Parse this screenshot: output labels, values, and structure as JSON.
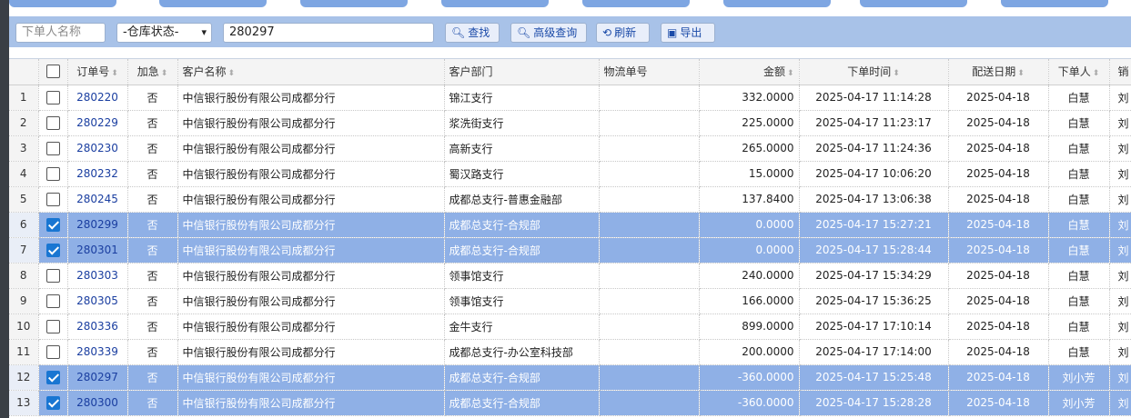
{
  "toolbar": {
    "orderer_placeholder": "下单人名称",
    "warehouse_status": "-仓库状态-",
    "search_value": "280297",
    "search_label": "查找",
    "advanced_label": "高级查询",
    "refresh_label": "刷新",
    "export_label": "导出"
  },
  "table": {
    "headers": [
      "订单号",
      "加急",
      "客户名称",
      "客户部门",
      "物流单号",
      "金额",
      "下单时间",
      "配送日期",
      "下单人",
      "销"
    ],
    "rows": [
      {
        "rn": "1",
        "checked": false,
        "id": "280220",
        "urgent": "否",
        "customer": "中信银行股份有限公司成都分行",
        "dept": "锦江支行",
        "logistics": "",
        "amount": "332.0000",
        "time": "2025-04-17 11:14:28",
        "date": "2025-04-18",
        "user": "白慧",
        "extra": "刘"
      },
      {
        "rn": "2",
        "checked": false,
        "id": "280229",
        "urgent": "否",
        "customer": "中信银行股份有限公司成都分行",
        "dept": "浆洗街支行",
        "logistics": "",
        "amount": "225.0000",
        "time": "2025-04-17 11:23:17",
        "date": "2025-04-18",
        "user": "白慧",
        "extra": "刘"
      },
      {
        "rn": "3",
        "checked": false,
        "id": "280230",
        "urgent": "否",
        "customer": "中信银行股份有限公司成都分行",
        "dept": "高新支行",
        "logistics": "",
        "amount": "265.0000",
        "time": "2025-04-17 11:24:36",
        "date": "2025-04-18",
        "user": "白慧",
        "extra": "刘"
      },
      {
        "rn": "4",
        "checked": false,
        "id": "280232",
        "urgent": "否",
        "customer": "中信银行股份有限公司成都分行",
        "dept": "蜀汉路支行",
        "logistics": "",
        "amount": "15.0000",
        "time": "2025-04-17 10:06:20",
        "date": "2025-04-18",
        "user": "白慧",
        "extra": "刘"
      },
      {
        "rn": "5",
        "checked": false,
        "id": "280245",
        "urgent": "否",
        "customer": "中信银行股份有限公司成都分行",
        "dept": "成都总支行-普惠金融部",
        "logistics": "",
        "amount": "137.8400",
        "time": "2025-04-17 13:06:38",
        "date": "2025-04-18",
        "user": "白慧",
        "extra": "刘"
      },
      {
        "rn": "6",
        "checked": true,
        "id": "280299",
        "urgent": "否",
        "customer": "中信银行股份有限公司成都分行",
        "dept": "成都总支行-合规部",
        "logistics": "",
        "amount": "0.0000",
        "time": "2025-04-17 15:27:21",
        "date": "2025-04-18",
        "user": "白慧",
        "extra": "刘"
      },
      {
        "rn": "7",
        "checked": true,
        "id": "280301",
        "urgent": "否",
        "customer": "中信银行股份有限公司成都分行",
        "dept": "成都总支行-合规部",
        "logistics": "",
        "amount": "0.0000",
        "time": "2025-04-17 15:28:44",
        "date": "2025-04-18",
        "user": "白慧",
        "extra": "刘"
      },
      {
        "rn": "8",
        "checked": false,
        "id": "280303",
        "urgent": "否",
        "customer": "中信银行股份有限公司成都分行",
        "dept": "领事馆支行",
        "logistics": "",
        "amount": "240.0000",
        "time": "2025-04-17 15:34:29",
        "date": "2025-04-18",
        "user": "白慧",
        "extra": "刘"
      },
      {
        "rn": "9",
        "checked": false,
        "id": "280305",
        "urgent": "否",
        "customer": "中信银行股份有限公司成都分行",
        "dept": "领事馆支行",
        "logistics": "",
        "amount": "166.0000",
        "time": "2025-04-17 15:36:25",
        "date": "2025-04-18",
        "user": "白慧",
        "extra": "刘"
      },
      {
        "rn": "10",
        "checked": false,
        "id": "280336",
        "urgent": "否",
        "customer": "中信银行股份有限公司成都分行",
        "dept": "金牛支行",
        "logistics": "",
        "amount": "899.0000",
        "time": "2025-04-17 17:10:14",
        "date": "2025-04-18",
        "user": "白慧",
        "extra": "刘"
      },
      {
        "rn": "11",
        "checked": false,
        "id": "280339",
        "urgent": "否",
        "customer": "中信银行股份有限公司成都分行",
        "dept": "成都总支行-办公室科技部",
        "logistics": "",
        "amount": "200.0000",
        "time": "2025-04-17 17:14:00",
        "date": "2025-04-18",
        "user": "白慧",
        "extra": "刘"
      },
      {
        "rn": "12",
        "checked": true,
        "id": "280297",
        "urgent": "否",
        "customer": "中信银行股份有限公司成都分行",
        "dept": "成都总支行-合规部",
        "logistics": "",
        "amount": "-360.0000",
        "time": "2025-04-17 15:25:48",
        "date": "2025-04-18",
        "user": "刘小芳",
        "extra": "刘"
      },
      {
        "rn": "13",
        "checked": true,
        "id": "280300",
        "urgent": "否",
        "customer": "中信银行股份有限公司成都分行",
        "dept": "成都总支行-合规部",
        "logistics": "",
        "amount": "-360.0000",
        "time": "2025-04-17 15:28:28",
        "date": "2025-04-18",
        "user": "刘小芳",
        "extra": "刘"
      }
    ]
  },
  "colors": {
    "toolbar_bg": "#a8c2e8",
    "selected_row": "#8fb0e6",
    "link": "#1a3ea0",
    "checkbox_checked": "#1976d2"
  }
}
